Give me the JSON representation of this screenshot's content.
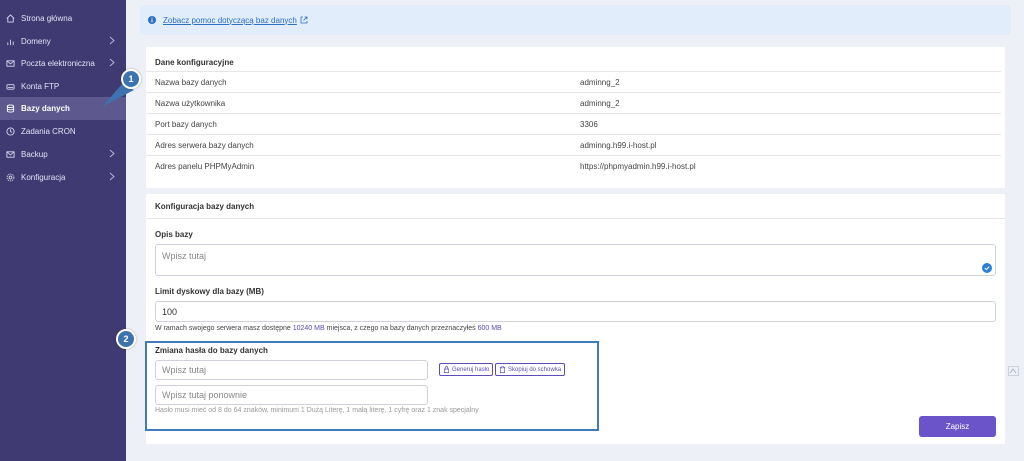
{
  "sidebar": {
    "items": [
      {
        "label": "Strona główna",
        "icon": "home-icon",
        "chevron": false
      },
      {
        "label": "Domeny",
        "icon": "bar-chart-icon",
        "chevron": true
      },
      {
        "label": "Poczta elektroniczna",
        "icon": "mail-icon",
        "chevron": true
      },
      {
        "label": "Konta FTP",
        "icon": "drive-icon",
        "chevron": false
      },
      {
        "label": "Bazy danych",
        "icon": "database-icon",
        "chevron": false,
        "active": true
      },
      {
        "label": "Zadania CRON",
        "icon": "clock-icon",
        "chevron": false
      },
      {
        "label": "Backup",
        "icon": "mail-icon",
        "chevron": true
      },
      {
        "label": "Konfiguracja",
        "icon": "gear-icon",
        "chevron": true
      }
    ]
  },
  "info": {
    "link_text": "Zobacz pomoc dotyczącą baz danych"
  },
  "config_data": {
    "title": "Dane konfiguracyjne",
    "rows": [
      {
        "key": "Nazwa bazy danych",
        "value": "adminng_2"
      },
      {
        "key": "Nazwa użytkownika",
        "value": "adminng_2"
      },
      {
        "key": "Port bazy danych",
        "value": "3306"
      },
      {
        "key": "Adres serwera bazy danych",
        "value": "adminng.h99.i-host.pl"
      },
      {
        "key": "Adres panelu PHPMyAdmin",
        "value": "https://phpmyadmin.h99.i-host.pl"
      }
    ]
  },
  "db_config": {
    "title": "Konfiguracja bazy danych",
    "desc_label": "Opis bazy",
    "desc_placeholder": "Wpisz tutaj",
    "limit_label": "Limit dyskowy dla bazy (MB)",
    "limit_value": "100",
    "note_pre": "W ramach swojego serwera masz dostępne",
    "note_total": "10240 MB",
    "note_mid": "miejsca, z czego na bazy danych przeznaczyłeś",
    "note_used": "600 MB",
    "password_label": "Zmiana hasła do bazy danych",
    "password_placeholder": "Wpisz tutaj",
    "password_repeat_placeholder": "Wpisz tutaj ponownie",
    "generate_label": "Generuj hasło",
    "copy_label": "Skopiuj do schowka",
    "password_hint": "Hasło musi mieć od 8 do 64 znaków, minimum 1 Dużą Literę, 1 małą literę, 1 cyfrę oraz 1 znak specjalny",
    "save_label": "Zapisz"
  },
  "annotations": {
    "badge1": "1",
    "badge2": "2"
  },
  "colors": {
    "sidebar": "#3f3a72",
    "accent": "#6b53c9",
    "highlight": "#3f7bbd"
  }
}
